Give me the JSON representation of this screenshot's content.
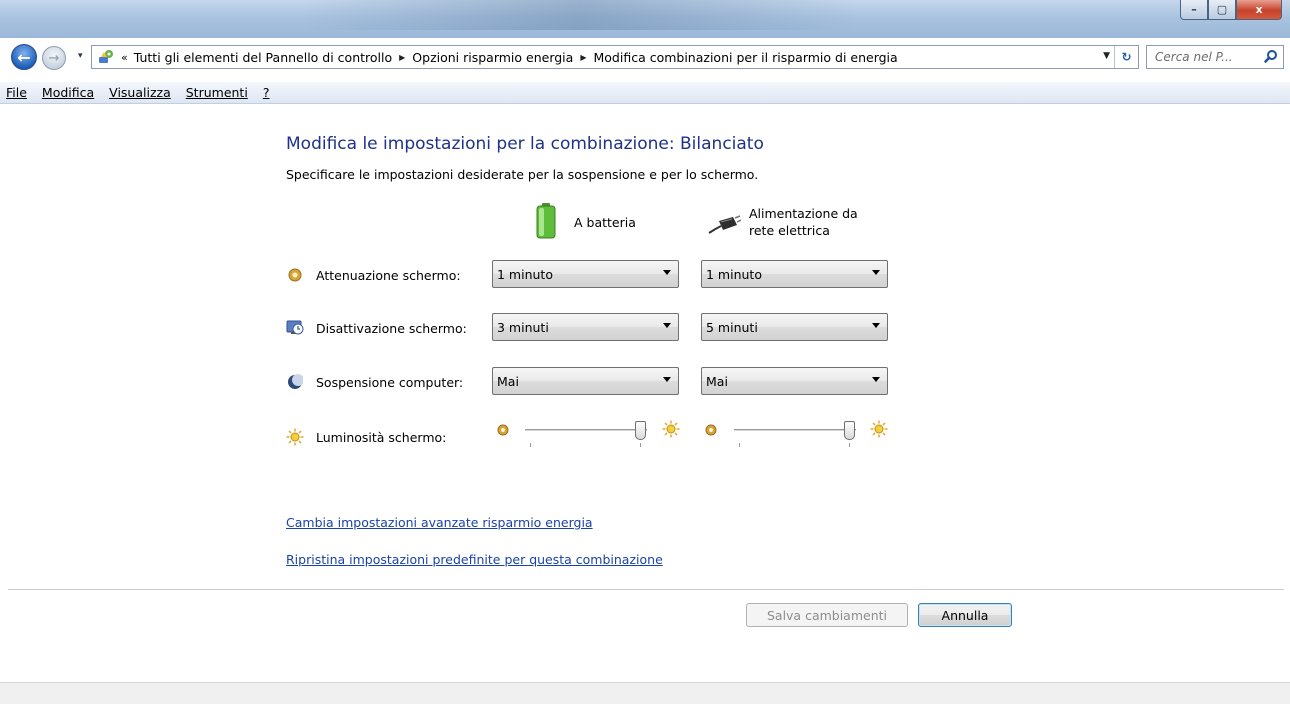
{
  "window": {
    "minimize_glyph": "–",
    "maximize_glyph": "▢",
    "close_glyph": "x"
  },
  "navigation": {
    "back_glyph": "←",
    "forward_glyph": "→",
    "history_glyph": "▾",
    "breadcrumb_prefix": "«",
    "breadcrumb": [
      "Tutti gli elementi del Pannello di controllo",
      "Opzioni risparmio energia",
      "Modifica combinazioni per il risparmio di energia"
    ],
    "breadcrumb_separator": "▶",
    "dropdown_glyph": "▼",
    "refresh_glyph": "↻",
    "search_placeholder": "Cerca nel P...",
    "search_glyph": "⚲"
  },
  "menu": [
    "File",
    "Modifica",
    "Visualizza",
    "Strumenti",
    "?"
  ],
  "page": {
    "heading": "Modifica le impostazioni per la combinazione: Bilanciato",
    "subheading": "Specificare le impostazioni desiderate per la sospensione e per lo schermo.",
    "columns": {
      "battery": "A batteria",
      "plugged_line1": "Alimentazione da",
      "plugged_line2": "rete elettrica"
    },
    "settings": [
      {
        "label": "Attenuazione schermo:",
        "icon": "dim-display-icon",
        "battery": "1 minuto",
        "plugged": "1 minuto"
      },
      {
        "label": "Disattivazione schermo:",
        "icon": "display-off-icon",
        "battery": "3 minuti",
        "plugged": "5 minuti"
      },
      {
        "label": "Sospensione computer:",
        "icon": "sleep-moon-icon",
        "battery": "Mai",
        "plugged": "Mai"
      }
    ],
    "brightness": {
      "label": "Luminosità schermo:",
      "battery_level": 1.0,
      "plugged_level": 1.0
    },
    "links": {
      "advanced": "Cambia impostazioni avanzate risparmio energia",
      "restore": "Ripristina impostazioni predefinite per questa combinazione"
    },
    "buttons": {
      "save": "Salva cambiamenti",
      "cancel": "Annulla"
    }
  },
  "colors": {
    "heading": "#1e3287",
    "link": "#1a43a6"
  }
}
